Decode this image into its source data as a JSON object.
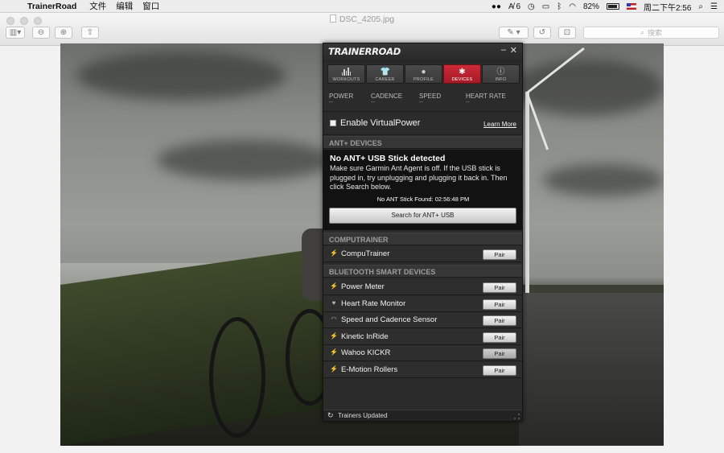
{
  "menubar": {
    "apple": "",
    "app_name": "TrainerRoad",
    "menus": [
      "文件",
      "编辑",
      "窗口"
    ],
    "status": {
      "wechat": "",
      "input": "6",
      "battery": "82%",
      "clock": "周二下午2:56"
    }
  },
  "window": {
    "title": "DSC_4205.jpg",
    "search_placeholder": "搜索"
  },
  "trainerroad": {
    "logo": "TRAINERROAD",
    "minimize": "–",
    "close": "✕",
    "tabs": [
      {
        "label": "WORKOUTS",
        "icon": "bar-chart-icon",
        "active": false
      },
      {
        "label": "CAREER",
        "icon": "shirt-icon",
        "active": false
      },
      {
        "label": "PROFILE",
        "icon": "person-icon",
        "active": false
      },
      {
        "label": "DEVICES",
        "icon": "gear-icon",
        "active": true
      },
      {
        "label": "INFO",
        "icon": "info-icon",
        "active": false
      }
    ],
    "metrics": [
      {
        "label": "POWER",
        "value": "--"
      },
      {
        "label": "CADENCE",
        "value": "--"
      },
      {
        "label": "SPEED",
        "value": "--"
      },
      {
        "label": "HEART RATE",
        "value": "--"
      }
    ],
    "virtual_power": {
      "label": "Enable VirtualPower",
      "checked": false,
      "learn_more": "Learn More"
    },
    "ant_section": "ANT+ DEVICES",
    "ant": {
      "heading": "No ANT+ USB Stick detected",
      "message": "Make sure Garmin Ant Agent is off. If the USB stick is plugged in, try unplugging and plugging it back in. Then click Search below.",
      "status": "No ANT Stick Found: 02:56:48 PM",
      "button": "Search for ANT+ USB"
    },
    "computrainer_section": "COMPUTRAINER",
    "computrainer": [
      {
        "label": "CompuTrainer",
        "icon": "bolt-icon",
        "button": "Pair"
      }
    ],
    "bluetooth_section": "BLUETOOTH SMART DEVICES",
    "bluetooth": [
      {
        "label": "Power Meter",
        "icon": "bolt-icon",
        "button": "Pair"
      },
      {
        "label": "Heart Rate Monitor",
        "icon": "heart-icon",
        "button": "Pair"
      },
      {
        "label": "Speed and Cadence Sensor",
        "icon": "gauge-icon",
        "button": "Pair"
      },
      {
        "label": "Kinetic InRide",
        "icon": "bolt-icon",
        "button": "Pair"
      },
      {
        "label": "Wahoo KICKR",
        "icon": "bolt-icon",
        "button": "Pair"
      },
      {
        "label": "E-Motion Rollers",
        "icon": "bolt-icon",
        "button": "Pair"
      }
    ],
    "status_bar": "Trainers Updated"
  }
}
